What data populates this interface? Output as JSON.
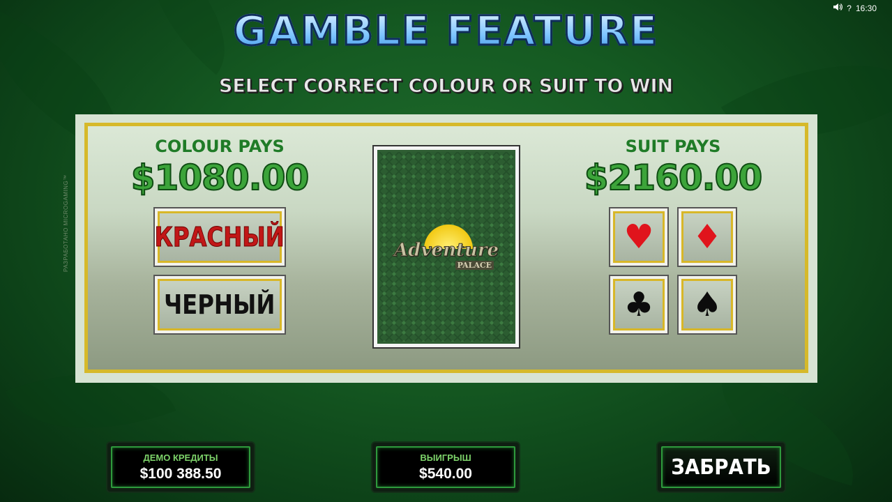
{
  "status": {
    "time": "16:30",
    "help": "?"
  },
  "header": {
    "title": "GAMBLE FEATURE",
    "subtitle": "SELECT CORRECT COLOUR OR SUIT TO WIN"
  },
  "colour": {
    "label": "COLOUR PAYS",
    "amount": "$1080.00",
    "red_label": "КРАСНЫЙ",
    "black_label": "ЧЕРНЫЙ"
  },
  "suit": {
    "label": "SUIT PAYS",
    "amount": "$2160.00",
    "hearts": "♥",
    "diamonds": "♦",
    "clubs": "♣",
    "spades": "♠"
  },
  "card": {
    "logo_word": "Adventure",
    "logo_sub": "PALACE"
  },
  "credit_vertical": "РАЗРАБОТАНО MICROGAMING™",
  "footer": {
    "demo_label": "ДЕМО КРЕДИТЫ",
    "demo_value": "$100 388.50",
    "win_label": "ВЫИГРЫШ",
    "win_value": "$540.00",
    "collect_label": "ЗАБРАТЬ"
  },
  "colors": {
    "background": "#155a22",
    "title_fill": "#7cc4ff",
    "pays_green": "#3ca43a",
    "red_suit": "#e0141c",
    "gold_border": "#d6b92a"
  },
  "icons": {
    "sound": "speaker-icon",
    "help": "question-icon"
  }
}
